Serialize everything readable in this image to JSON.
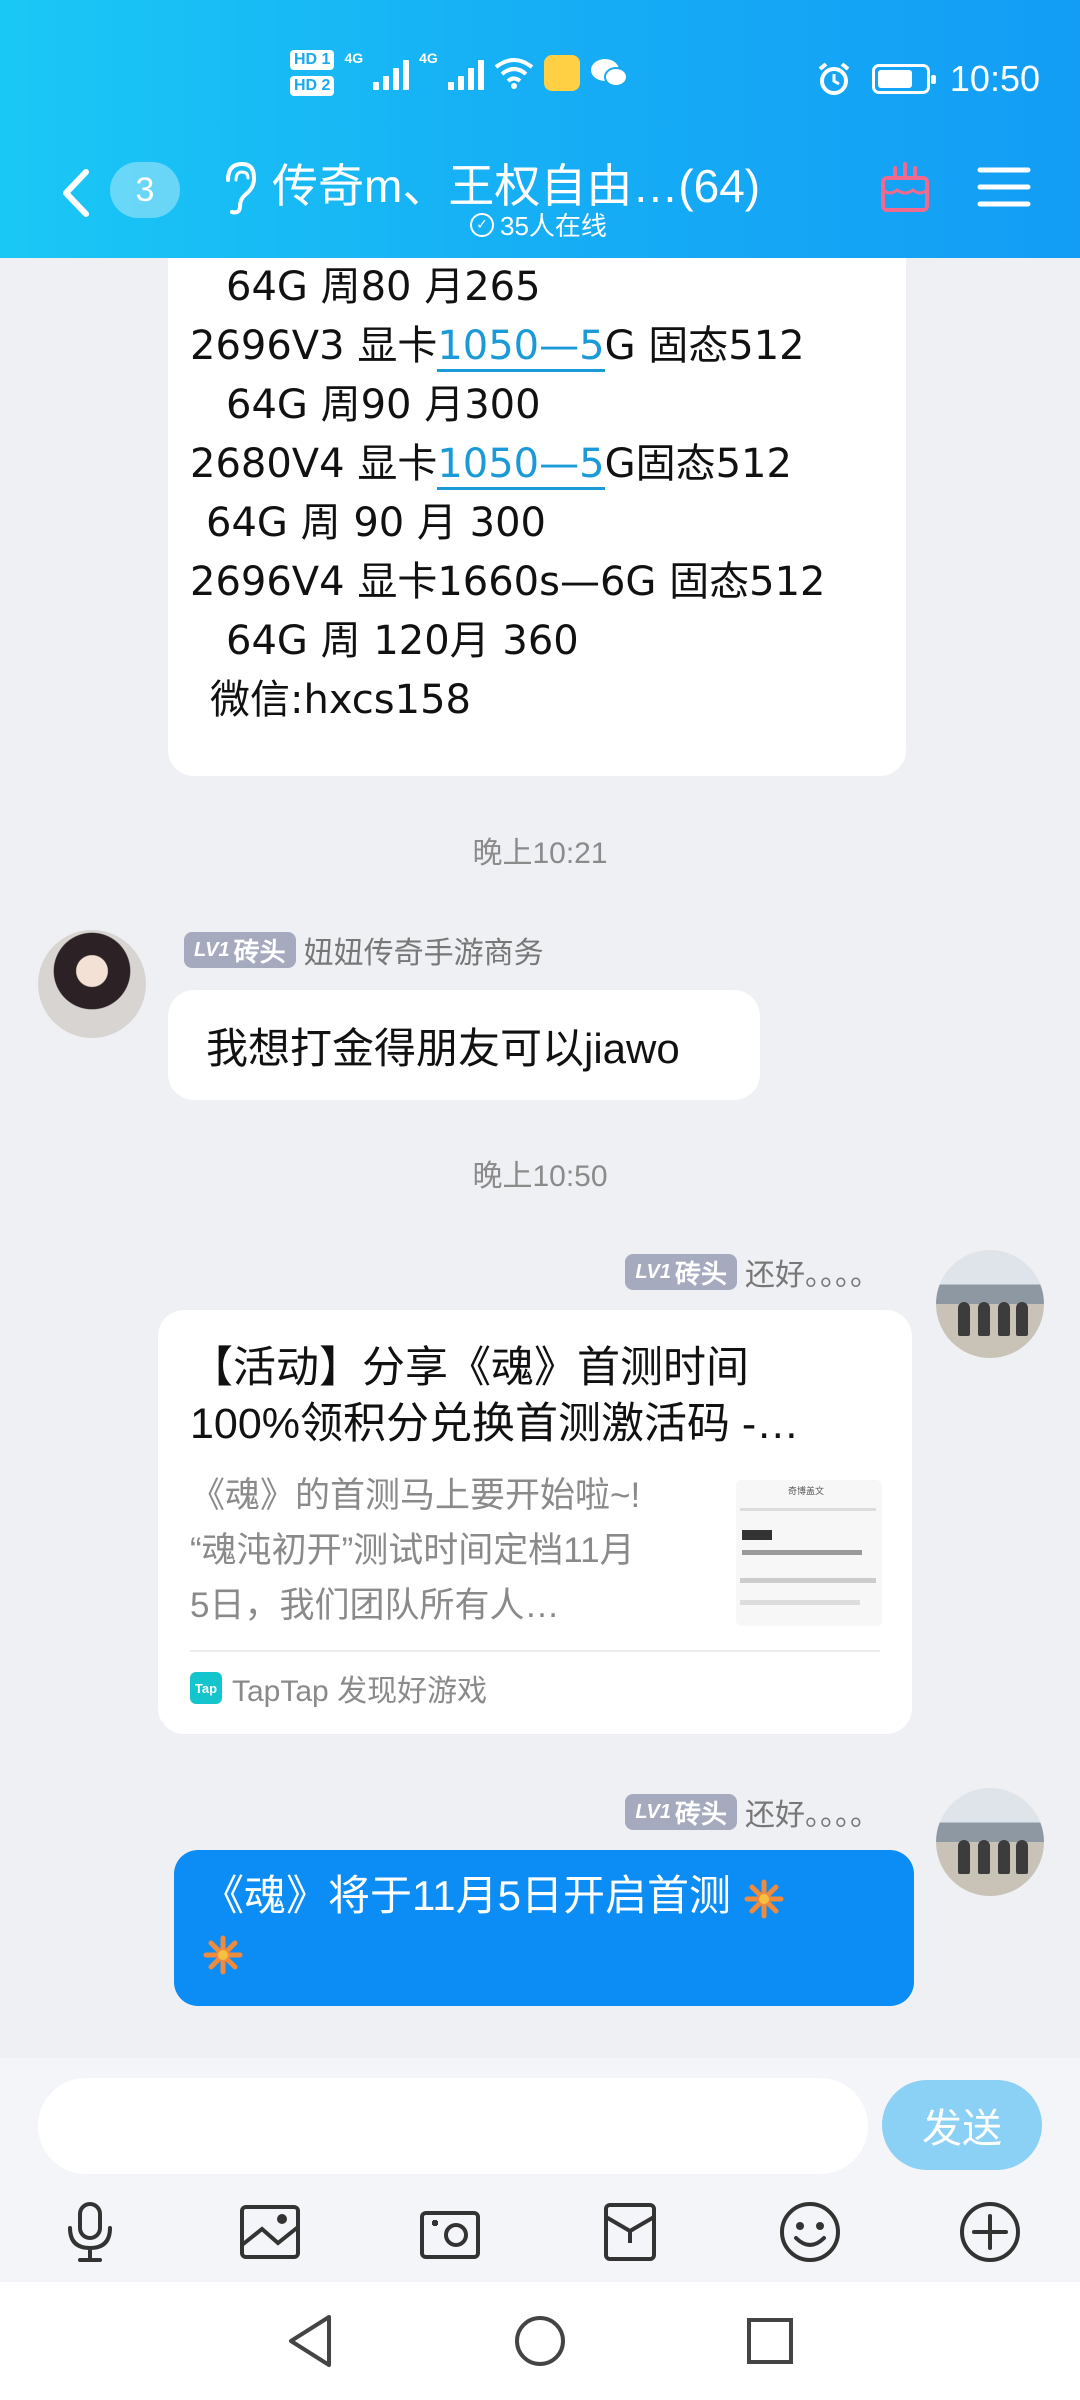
{
  "status_bar": {
    "time": "10:50",
    "network_1": "4G",
    "network_2": "4G",
    "hd_1": "HD 1",
    "hd_2": "HD 2"
  },
  "header": {
    "unread_count": "3",
    "title": "传奇m、王权自由…(64)",
    "online": "35人在线"
  },
  "spec_message": {
    "lines": [
      " 64G  周80  月265",
      "2696V3  显卡1050—5G 固态512",
      " 64G  周90  月300",
      "2680V4 显卡1050—5G固态512",
      "64G 周 90  月  300",
      "2696V4 显卡1660s—6G 固态512",
      " 64G 周 120月 360",
      "微信:hxcs158"
    ]
  },
  "messages": [
    {
      "timestamp": "晚上10:21",
      "level": "LV1",
      "rank": "砖头",
      "sender": "妞妞传奇手游商务",
      "text": "我想打金得朋友可以jiawo"
    },
    {
      "timestamp": "晚上10:50",
      "level": "LV1",
      "rank": "砖头",
      "sender": "还好。。。。",
      "card": {
        "title_1": "【活动】分享《魂》首测时间",
        "title_2": "100%领积分兑换首测激活码 -…",
        "desc_1": "《魂》的首测马上要开始啦~!",
        "desc_2": "“魂沌初开”测试时间定档11月",
        "desc_3": "5日，我们团队所有人…",
        "source": "TapTap 发现好游戏",
        "source_icon": "Tap",
        "thumb_title": "奇博盖文"
      }
    },
    {
      "level": "LV1",
      "rank": "砖头",
      "sender": "还好。。。。",
      "text": "《魂》将于11月5日开启首测"
    }
  ],
  "input": {
    "placeholder": "",
    "send_label": "发送"
  },
  "toolbar": {
    "icons": [
      "microphone-icon",
      "image-icon",
      "camera-icon",
      "red-packet-icon",
      "emoji-icon",
      "plus-icon"
    ]
  },
  "colors": {
    "header_start": "#1ac8f5",
    "header_end": "#139df5",
    "bubble_blue": "#0c8cf5",
    "send_button": "#8bd0f5",
    "level_badge": "#a5aabf",
    "link_blue": "#1a9ad6"
  }
}
